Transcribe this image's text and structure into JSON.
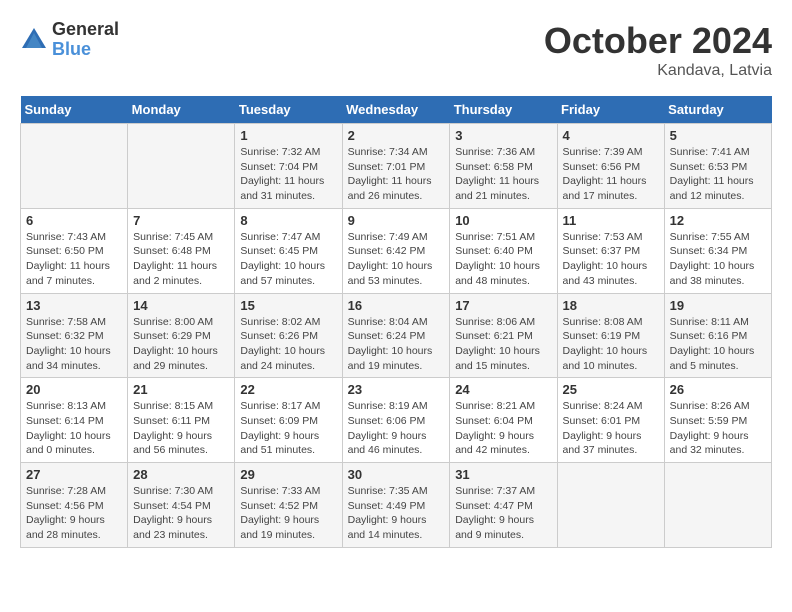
{
  "header": {
    "logo_line1": "General",
    "logo_line2": "Blue",
    "month": "October 2024",
    "location": "Kandava, Latvia"
  },
  "columns": [
    "Sunday",
    "Monday",
    "Tuesday",
    "Wednesday",
    "Thursday",
    "Friday",
    "Saturday"
  ],
  "weeks": [
    [
      {
        "day": "",
        "detail": ""
      },
      {
        "day": "",
        "detail": ""
      },
      {
        "day": "1",
        "detail": "Sunrise: 7:32 AM\nSunset: 7:04 PM\nDaylight: 11 hours and 31 minutes."
      },
      {
        "day": "2",
        "detail": "Sunrise: 7:34 AM\nSunset: 7:01 PM\nDaylight: 11 hours and 26 minutes."
      },
      {
        "day": "3",
        "detail": "Sunrise: 7:36 AM\nSunset: 6:58 PM\nDaylight: 11 hours and 21 minutes."
      },
      {
        "day": "4",
        "detail": "Sunrise: 7:39 AM\nSunset: 6:56 PM\nDaylight: 11 hours and 17 minutes."
      },
      {
        "day": "5",
        "detail": "Sunrise: 7:41 AM\nSunset: 6:53 PM\nDaylight: 11 hours and 12 minutes."
      }
    ],
    [
      {
        "day": "6",
        "detail": "Sunrise: 7:43 AM\nSunset: 6:50 PM\nDaylight: 11 hours and 7 minutes."
      },
      {
        "day": "7",
        "detail": "Sunrise: 7:45 AM\nSunset: 6:48 PM\nDaylight: 11 hours and 2 minutes."
      },
      {
        "day": "8",
        "detail": "Sunrise: 7:47 AM\nSunset: 6:45 PM\nDaylight: 10 hours and 57 minutes."
      },
      {
        "day": "9",
        "detail": "Sunrise: 7:49 AM\nSunset: 6:42 PM\nDaylight: 10 hours and 53 minutes."
      },
      {
        "day": "10",
        "detail": "Sunrise: 7:51 AM\nSunset: 6:40 PM\nDaylight: 10 hours and 48 minutes."
      },
      {
        "day": "11",
        "detail": "Sunrise: 7:53 AM\nSunset: 6:37 PM\nDaylight: 10 hours and 43 minutes."
      },
      {
        "day": "12",
        "detail": "Sunrise: 7:55 AM\nSunset: 6:34 PM\nDaylight: 10 hours and 38 minutes."
      }
    ],
    [
      {
        "day": "13",
        "detail": "Sunrise: 7:58 AM\nSunset: 6:32 PM\nDaylight: 10 hours and 34 minutes."
      },
      {
        "day": "14",
        "detail": "Sunrise: 8:00 AM\nSunset: 6:29 PM\nDaylight: 10 hours and 29 minutes."
      },
      {
        "day": "15",
        "detail": "Sunrise: 8:02 AM\nSunset: 6:26 PM\nDaylight: 10 hours and 24 minutes."
      },
      {
        "day": "16",
        "detail": "Sunrise: 8:04 AM\nSunset: 6:24 PM\nDaylight: 10 hours and 19 minutes."
      },
      {
        "day": "17",
        "detail": "Sunrise: 8:06 AM\nSunset: 6:21 PM\nDaylight: 10 hours and 15 minutes."
      },
      {
        "day": "18",
        "detail": "Sunrise: 8:08 AM\nSunset: 6:19 PM\nDaylight: 10 hours and 10 minutes."
      },
      {
        "day": "19",
        "detail": "Sunrise: 8:11 AM\nSunset: 6:16 PM\nDaylight: 10 hours and 5 minutes."
      }
    ],
    [
      {
        "day": "20",
        "detail": "Sunrise: 8:13 AM\nSunset: 6:14 PM\nDaylight: 10 hours and 0 minutes."
      },
      {
        "day": "21",
        "detail": "Sunrise: 8:15 AM\nSunset: 6:11 PM\nDaylight: 9 hours and 56 minutes."
      },
      {
        "day": "22",
        "detail": "Sunrise: 8:17 AM\nSunset: 6:09 PM\nDaylight: 9 hours and 51 minutes."
      },
      {
        "day": "23",
        "detail": "Sunrise: 8:19 AM\nSunset: 6:06 PM\nDaylight: 9 hours and 46 minutes."
      },
      {
        "day": "24",
        "detail": "Sunrise: 8:21 AM\nSunset: 6:04 PM\nDaylight: 9 hours and 42 minutes."
      },
      {
        "day": "25",
        "detail": "Sunrise: 8:24 AM\nSunset: 6:01 PM\nDaylight: 9 hours and 37 minutes."
      },
      {
        "day": "26",
        "detail": "Sunrise: 8:26 AM\nSunset: 5:59 PM\nDaylight: 9 hours and 32 minutes."
      }
    ],
    [
      {
        "day": "27",
        "detail": "Sunrise: 7:28 AM\nSunset: 4:56 PM\nDaylight: 9 hours and 28 minutes."
      },
      {
        "day": "28",
        "detail": "Sunrise: 7:30 AM\nSunset: 4:54 PM\nDaylight: 9 hours and 23 minutes."
      },
      {
        "day": "29",
        "detail": "Sunrise: 7:33 AM\nSunset: 4:52 PM\nDaylight: 9 hours and 19 minutes."
      },
      {
        "day": "30",
        "detail": "Sunrise: 7:35 AM\nSunset: 4:49 PM\nDaylight: 9 hours and 14 minutes."
      },
      {
        "day": "31",
        "detail": "Sunrise: 7:37 AM\nSunset: 4:47 PM\nDaylight: 9 hours and 9 minutes."
      },
      {
        "day": "",
        "detail": ""
      },
      {
        "day": "",
        "detail": ""
      }
    ]
  ]
}
